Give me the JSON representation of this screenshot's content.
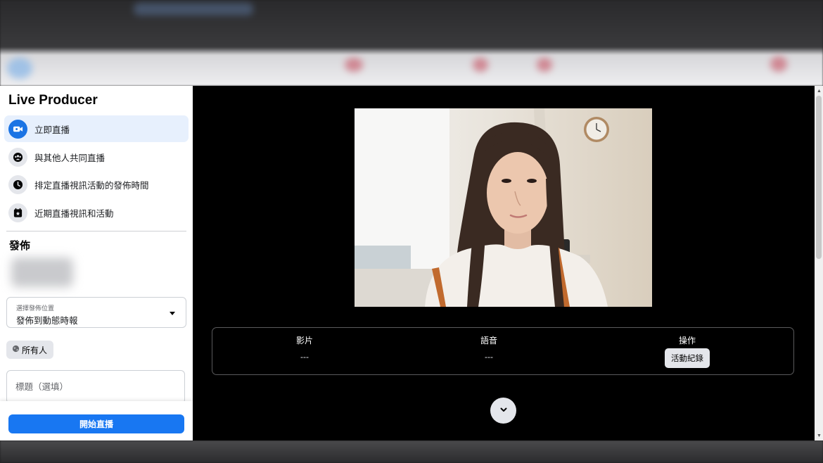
{
  "sidebar": {
    "title": "Live Producer",
    "nav": [
      {
        "label": "立即直播",
        "icon": "video-camera-icon",
        "active": true
      },
      {
        "label": "與其他人共同直播",
        "icon": "group-icon",
        "active": false
      },
      {
        "label": "排定直播視訊活動的發佈時間",
        "icon": "clock-icon",
        "active": false
      },
      {
        "label": "近期直播視訊和活動",
        "icon": "calendar-star-icon",
        "active": false
      }
    ],
    "publish_heading": "發佈",
    "destination": {
      "caption": "選擇發佈位置",
      "value": "發佈到動態時報"
    },
    "privacy": {
      "label": "所有人",
      "icon": "globe-icon"
    },
    "title_field": {
      "placeholder": "標題（選填）",
      "value": ""
    },
    "go_live_label": "開始直播"
  },
  "stats": {
    "video_label": "影片",
    "video_value": "---",
    "audio_label": "語音",
    "audio_value": "---",
    "actions_label": "操作",
    "activity_log_label": "活動紀錄"
  },
  "colors": {
    "accent": "#1877f2",
    "active_bg": "#e7f0fd",
    "panel": "#ffffff",
    "stage": "#000000"
  }
}
